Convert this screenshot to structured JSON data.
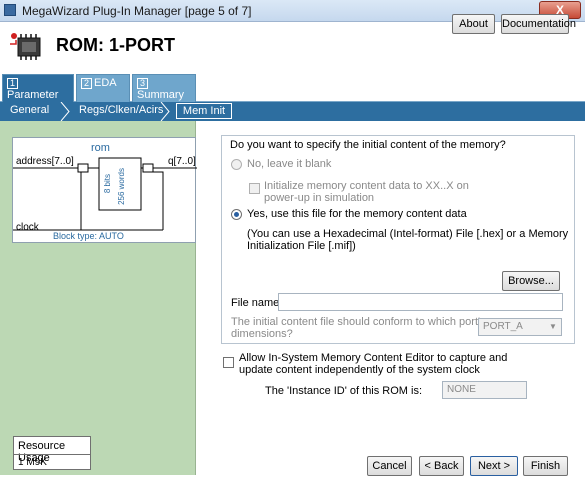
{
  "window": {
    "title": "MegaWizard Plug-In Manager [page 5 of 7]",
    "close_label": "X"
  },
  "header": {
    "title": "ROM: 1-PORT",
    "about_label": "About",
    "documentation_label": "Documentation"
  },
  "tabs": [
    {
      "num": "1",
      "label": "Parameter Settings"
    },
    {
      "num": "2",
      "label": "EDA"
    },
    {
      "num": "3",
      "label": "Summary"
    }
  ],
  "breadcrumbs": [
    "General",
    "Regs/Clken/Acirs",
    "Mem Init"
  ],
  "schematic": {
    "title": "rom",
    "address": "address[7..0]",
    "q": "q[7..0]",
    "clock": "clock",
    "bits": "8 bits",
    "words": "256 words",
    "block_type": "Block type: AUTO"
  },
  "resource": {
    "title": "Resource Usage",
    "value": "1 M9K"
  },
  "form": {
    "question": "Do you want to specify the initial content of the memory?",
    "option_no": "No, leave it blank",
    "init_line1": "Initialize memory content data to XX..X on",
    "init_line2": "power-up in simulation",
    "option_yes": "Yes, use this file for the memory content data",
    "hint_line1": "(You can use a Hexadecimal (Intel-format) File [.hex] or a Memory",
    "hint_line2": "Initialization File [.mif])",
    "browse_label": "Browse...",
    "file_name_label": "File name:",
    "file_name_value": "",
    "port_line1": "The initial content file should conform to which port's",
    "port_line2": "dimensions?",
    "port_value": "PORT_A",
    "editor_line1": "Allow In-System Memory Content Editor to capture and",
    "editor_line2": "update content independently of the system clock",
    "instance_label": "The 'Instance ID' of this ROM is:",
    "instance_value": "NONE"
  },
  "buttons": {
    "cancel": "Cancel",
    "back": "< Back",
    "next": "Next >",
    "finish": "Finish"
  }
}
